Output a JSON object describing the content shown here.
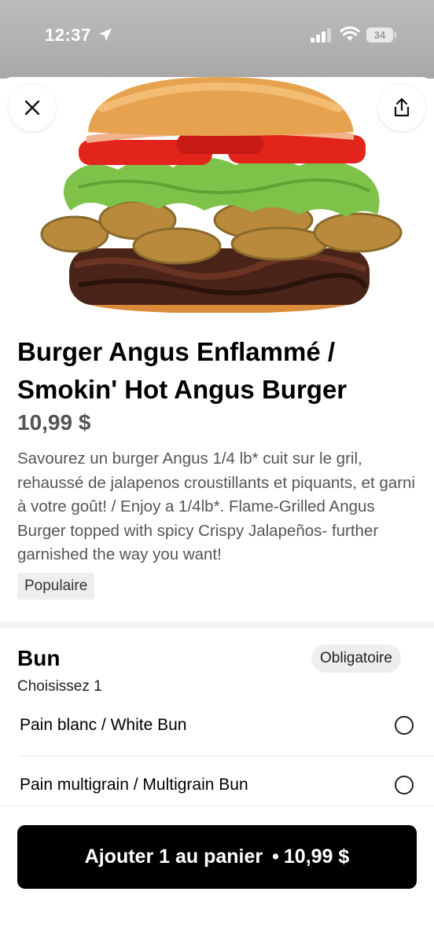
{
  "status_bar": {
    "time": "12:37",
    "battery": "34",
    "icons": [
      "location-arrow-icon",
      "signal-icon",
      "wifi-icon",
      "battery-icon"
    ]
  },
  "header": {
    "close_icon": "close-icon",
    "share_icon": "share-icon"
  },
  "item": {
    "title": "Burger Angus Enflammé / Smokin' Hot Angus Burger",
    "price": "10,99 $",
    "description": "Savourez un burger Angus 1/4 lb* cuit sur le gril, rehaussé de jalapenos croustillants et piquants, et garni à votre goût!           / Enjoy a 1/4lb*. Flame-Grilled Angus Burger topped with spicy Crispy Jalapeños- further garnished the way you want!",
    "badge": "Populaire"
  },
  "options_group": {
    "title": "Bun",
    "subtitle": "Choisissez 1",
    "required_label": "Obligatoire",
    "options": [
      {
        "label": "Pain blanc / White Bun",
        "selected": false
      },
      {
        "label": "Pain multigrain / Multigrain Bun",
        "selected": false
      }
    ]
  },
  "cart_button": {
    "label": "Ajouter 1 au panier",
    "separator": "•",
    "price": "10,99 $"
  },
  "colors": {
    "button_bg": "#000000",
    "badge_bg": "#eeeeee",
    "price_text": "#545454"
  }
}
